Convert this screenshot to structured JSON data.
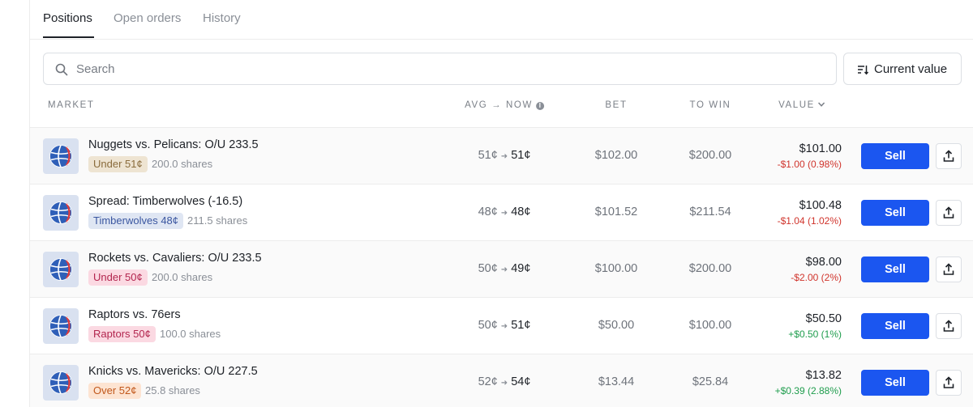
{
  "tabs": [
    {
      "label": "Positions",
      "active": true
    },
    {
      "label": "Open orders",
      "active": false
    },
    {
      "label": "History",
      "active": false
    }
  ],
  "search": {
    "placeholder": "Search",
    "value": ""
  },
  "sort_button": {
    "label": "Current value",
    "icon": "sort-icon"
  },
  "columns": {
    "market": "MARKET",
    "avg_now": "AVG → NOW",
    "bet": "BET",
    "to_win": "TO WIN",
    "value": "VALUE"
  },
  "rows": [
    {
      "title": "Nuggets vs. Pelicans: O/U 233.5",
      "badge": "Under 51¢",
      "badge_color": "tan",
      "shares": "200.0 shares",
      "avg": "51¢",
      "now": "51¢",
      "bet": "$102.00",
      "to_win": "$200.00",
      "value": "$101.00",
      "change": "-$1.00 (0.98%)",
      "change_dir": "neg",
      "sell_label": "Sell"
    },
    {
      "title": "Spread: Timberwolves (-16.5)",
      "badge": "Timberwolves 48¢",
      "badge_color": "blue",
      "shares": "211.5 shares",
      "avg": "48¢",
      "now": "48¢",
      "bet": "$101.52",
      "to_win": "$211.54",
      "value": "$100.48",
      "change": "-$1.04 (1.02%)",
      "change_dir": "neg",
      "sell_label": "Sell"
    },
    {
      "title": "Rockets vs. Cavaliers: O/U 233.5",
      "badge": "Under 50¢",
      "badge_color": "pink",
      "shares": "200.0 shares",
      "avg": "50¢",
      "now": "49¢",
      "bet": "$100.00",
      "to_win": "$200.00",
      "value": "$98.00",
      "change": "-$2.00 (2%)",
      "change_dir": "neg",
      "sell_label": "Sell"
    },
    {
      "title": "Raptors vs. 76ers",
      "badge": "Raptors 50¢",
      "badge_color": "pink",
      "shares": "100.0 shares",
      "avg": "50¢",
      "now": "51¢",
      "bet": "$50.00",
      "to_win": "$100.00",
      "value": "$50.50",
      "change": "+$0.50 (1%)",
      "change_dir": "pos",
      "sell_label": "Sell"
    },
    {
      "title": "Knicks vs. Mavericks: O/U 227.5",
      "badge": "Over 52¢",
      "badge_color": "orange",
      "shares": "25.8 shares",
      "avg": "52¢",
      "now": "54¢",
      "bet": "$13.44",
      "to_win": "$25.84",
      "value": "$13.82",
      "change": "+$0.39 (2.88%)",
      "change_dir": "pos",
      "sell_label": "Sell"
    }
  ],
  "colors": {
    "sell_button": "#1b56f0",
    "negative": "#d0342c",
    "positive": "#1f9d4d",
    "logo_bg": "#d9e1f0"
  },
  "icons": {
    "row_logo": "basketball-icon",
    "share": "share-upload-icon",
    "search": "search-icon",
    "sort": "sort-icon",
    "value_sort": "chevron-down-icon",
    "info": "info-icon"
  }
}
